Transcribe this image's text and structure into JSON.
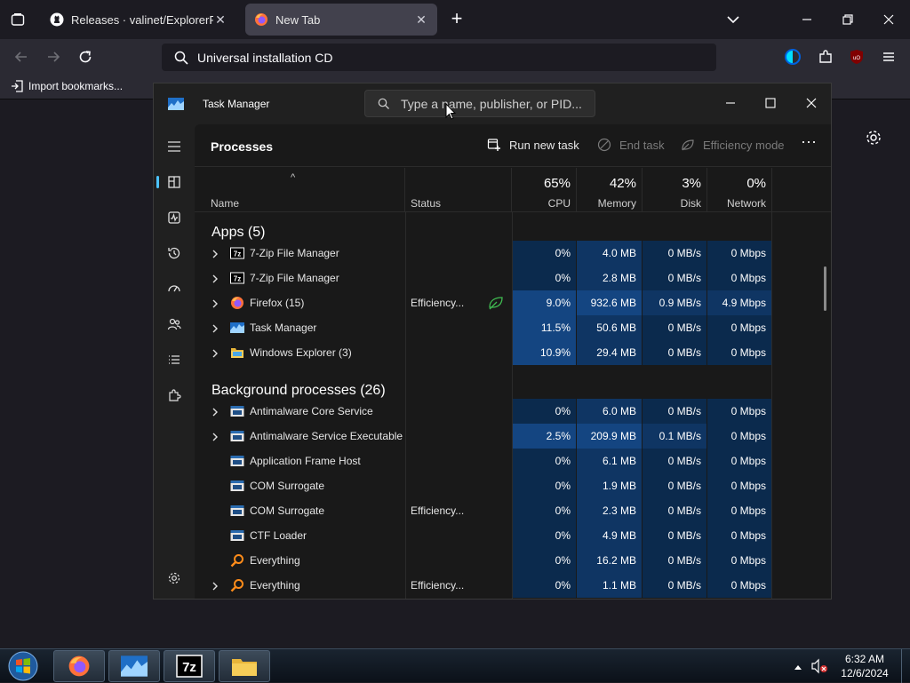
{
  "browser": {
    "tabs": [
      {
        "title": "Releases · valinet/ExplorerPatch",
        "active": false,
        "favicon": "github-icon"
      },
      {
        "title": "New Tab",
        "active": true,
        "favicon": "firefox-icon"
      }
    ],
    "url_value": "Universal installation CD",
    "bookmark_import": "Import bookmarks..."
  },
  "taskmgr": {
    "window_title": "Task Manager",
    "search_placeholder": "Type a name, publisher, or PID...",
    "page_title": "Processes",
    "toolbar": {
      "run_new_task": "Run new task",
      "end_task": "End task",
      "efficiency_mode": "Efficiency mode"
    },
    "columns": {
      "name": "Name",
      "status": "Status",
      "cpu": {
        "pct": "65%",
        "label": "CPU"
      },
      "memory": {
        "pct": "42%",
        "label": "Memory"
      },
      "disk": {
        "pct": "3%",
        "label": "Disk"
      },
      "network": {
        "pct": "0%",
        "label": "Network"
      }
    },
    "groups": {
      "apps": "Apps (5)",
      "background": "Background processes (26)"
    },
    "apps": [
      {
        "name": "7-Zip File Manager",
        "status": "",
        "cpu": "0%",
        "mem": "4.0 MB",
        "disk": "0 MB/s",
        "net": "0 Mbps",
        "icon": "sevenzip-icon"
      },
      {
        "name": "7-Zip File Manager",
        "status": "",
        "cpu": "0%",
        "mem": "2.8 MB",
        "disk": "0 MB/s",
        "net": "0 Mbps",
        "icon": "sevenzip-icon"
      },
      {
        "name": "Firefox (15)",
        "status": "Efficiency...",
        "cpu": "9.0%",
        "mem": "932.6 MB",
        "disk": "0.9 MB/s",
        "net": "4.9 Mbps",
        "icon": "firefox-icon"
      },
      {
        "name": "Task Manager",
        "status": "",
        "cpu": "11.5%",
        "mem": "50.6 MB",
        "disk": "0 MB/s",
        "net": "0 Mbps",
        "icon": "taskmanager-icon"
      },
      {
        "name": "Windows Explorer (3)",
        "status": "",
        "cpu": "10.9%",
        "mem": "29.4 MB",
        "disk": "0 MB/s",
        "net": "0 Mbps",
        "icon": "explorer-icon"
      }
    ],
    "background": [
      {
        "name": "Antimalware Core Service",
        "status": "",
        "cpu": "0%",
        "mem": "6.0 MB",
        "disk": "0 MB/s",
        "net": "0 Mbps",
        "icon": "service-icon"
      },
      {
        "name": "Antimalware Service Executable",
        "status": "",
        "cpu": "2.5%",
        "mem": "209.9 MB",
        "disk": "0.1 MB/s",
        "net": "0 Mbps",
        "icon": "service-icon"
      },
      {
        "name": "Application Frame Host",
        "status": "",
        "cpu": "0%",
        "mem": "6.1 MB",
        "disk": "0 MB/s",
        "net": "0 Mbps",
        "icon": "service-icon"
      },
      {
        "name": "COM Surrogate",
        "status": "",
        "cpu": "0%",
        "mem": "1.9 MB",
        "disk": "0 MB/s",
        "net": "0 Mbps",
        "icon": "service-icon"
      },
      {
        "name": "COM Surrogate",
        "status": "Efficiency...",
        "cpu": "0%",
        "mem": "2.3 MB",
        "disk": "0 MB/s",
        "net": "0 Mbps",
        "icon": "service-icon"
      },
      {
        "name": "CTF Loader",
        "status": "",
        "cpu": "0%",
        "mem": "4.9 MB",
        "disk": "0 MB/s",
        "net": "0 Mbps",
        "icon": "service-icon"
      },
      {
        "name": "Everything",
        "status": "",
        "cpu": "0%",
        "mem": "16.2 MB",
        "disk": "0 MB/s",
        "net": "0 Mbps",
        "icon": "everything-search-icon"
      },
      {
        "name": "Everything",
        "status": "Efficiency...",
        "cpu": "0%",
        "mem": "1.1 MB",
        "disk": "0 MB/s",
        "net": "0 Mbps",
        "icon": "everything-search-icon"
      }
    ]
  },
  "taskbar": {
    "clock_time": "6:32 AM",
    "clock_date": "12/6/2024"
  },
  "colors": {
    "heat_low": "#0b2a4d",
    "heat_mid": "#0f3563",
    "heat_high": "#144581",
    "accent": "#4cc2ff"
  }
}
